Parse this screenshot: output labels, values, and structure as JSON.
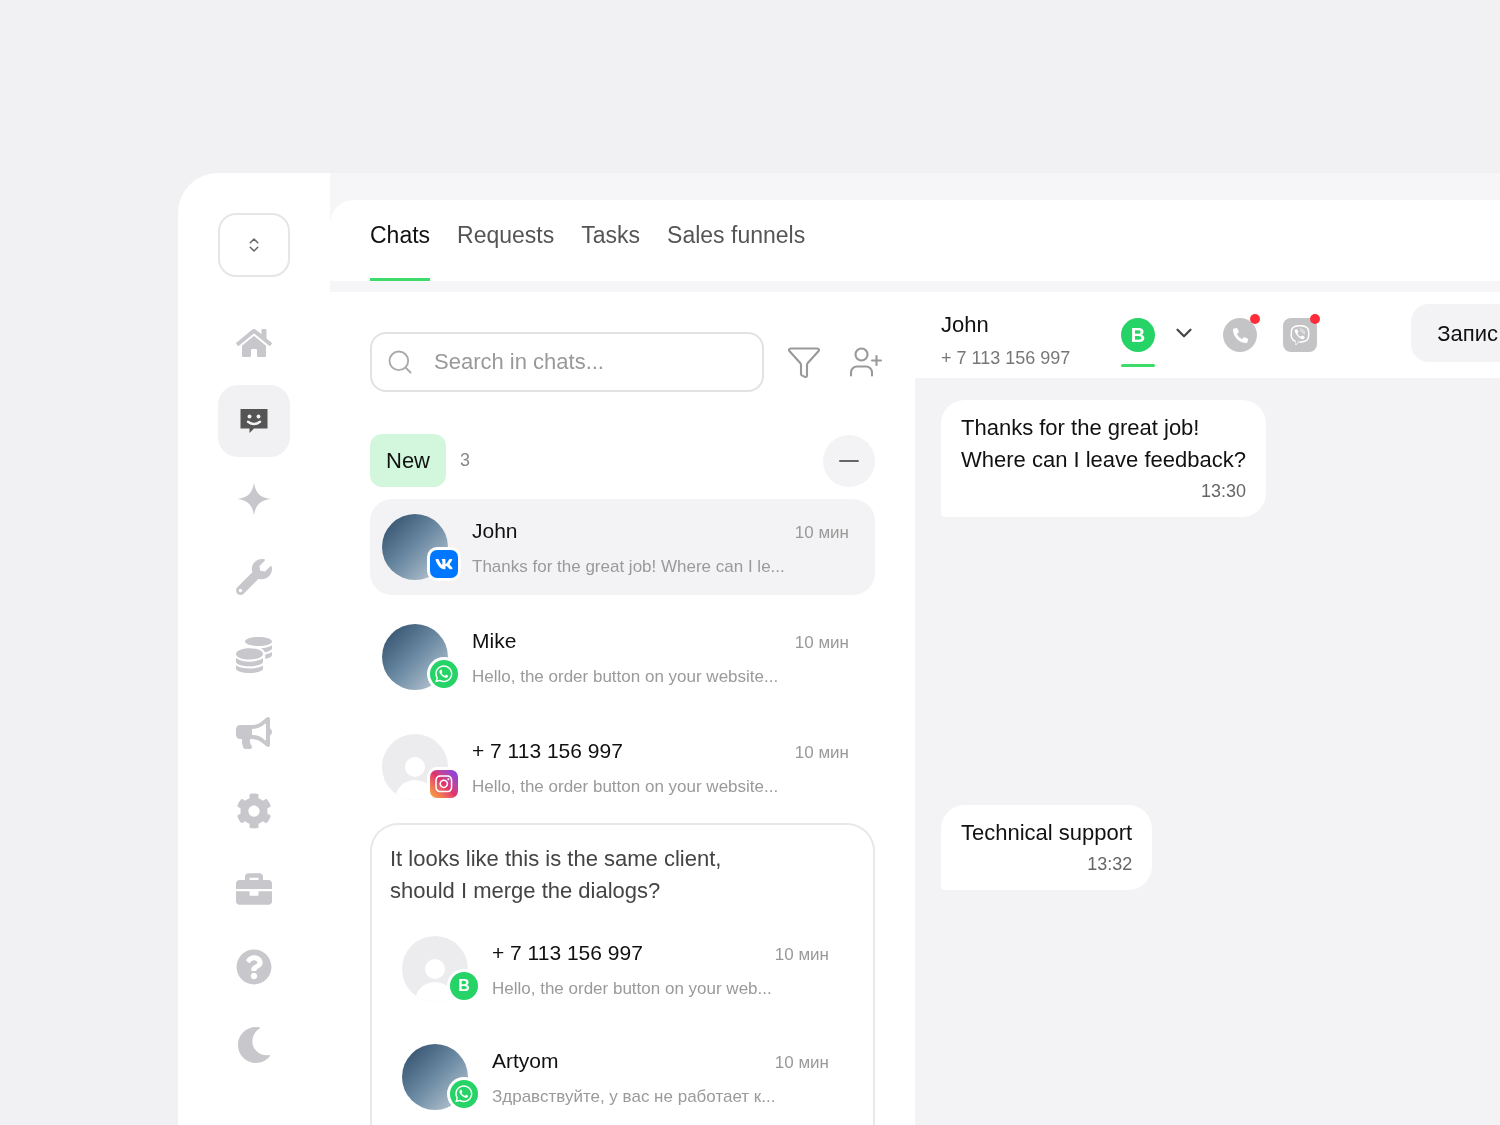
{
  "sidebar": {
    "items": [
      {
        "kind": "home",
        "selected": false
      },
      {
        "kind": "chat",
        "selected": true
      },
      {
        "kind": "sparkle",
        "selected": false
      },
      {
        "kind": "wrench",
        "selected": false
      },
      {
        "kind": "coins",
        "selected": false
      },
      {
        "kind": "megaphone",
        "selected": false
      },
      {
        "kind": "settings",
        "selected": false
      },
      {
        "kind": "briefcase",
        "selected": false
      },
      {
        "kind": "help",
        "selected": false
      },
      {
        "kind": "moon",
        "selected": false
      }
    ]
  },
  "tabs": [
    {
      "label": "Chats",
      "selected": true
    },
    {
      "label": "Requests",
      "selected": false
    },
    {
      "label": "Tasks",
      "selected": false
    },
    {
      "label": "Sales funnels",
      "selected": false
    }
  ],
  "search": {
    "placeholder": "Search in chats..."
  },
  "group": {
    "label": "New",
    "count": "3",
    "expanded": true
  },
  "chats": [
    {
      "name": "John",
      "time": "10 мин",
      "preview": "Thanks for the great job! Where can I le...",
      "avatar": {
        "kind": "photo"
      },
      "channel": {
        "kind": "vk"
      },
      "selected": true
    },
    {
      "name": "Mike",
      "time": "10 мин",
      "preview": "Hello, the order button on your website...",
      "avatar": {
        "kind": "photo"
      },
      "channel": {
        "kind": "whatsapp"
      },
      "selected": false
    },
    {
      "name": "+ 7 113 156 997",
      "time": "10 мин",
      "preview": "Hello, the order button on your website...",
      "avatar": {
        "kind": "silhouette"
      },
      "channel": {
        "kind": "instagram"
      },
      "selected": false
    }
  ],
  "merge": {
    "prompt": "It looks like this is the same client,\nshould I merge the dialogs?",
    "chats": [
      {
        "name": "+ 7 113 156 997",
        "time": "10 мин",
        "preview": "Hello, the order button on your web...",
        "avatar": {
          "kind": "silhouette"
        },
        "channel": {
          "kind": "business",
          "label": "B"
        },
        "selected": false
      },
      {
        "name": "Artyom",
        "time": "10 мин",
        "preview": "Здравствуйте, у вас не работает к...",
        "avatar": {
          "kind": "photo"
        },
        "channel": {
          "kind": "whatsapp"
        },
        "selected": false
      }
    ]
  },
  "conversation": {
    "name": "John",
    "phone": "+ 7 113 156 997",
    "channels": [
      {
        "kind": "business",
        "label": "B",
        "selected": true,
        "unread": false
      },
      {
        "kind": "phone",
        "selected": false,
        "unread": true
      },
      {
        "kind": "viber",
        "selected": false,
        "unread": true
      }
    ],
    "action": "Запис",
    "messages": [
      {
        "text": "Thanks for the great job!\nWhere can I leave feedback?",
        "time": "13:30"
      },
      {
        "text": "Technical support",
        "time": "13:32"
      }
    ]
  }
}
